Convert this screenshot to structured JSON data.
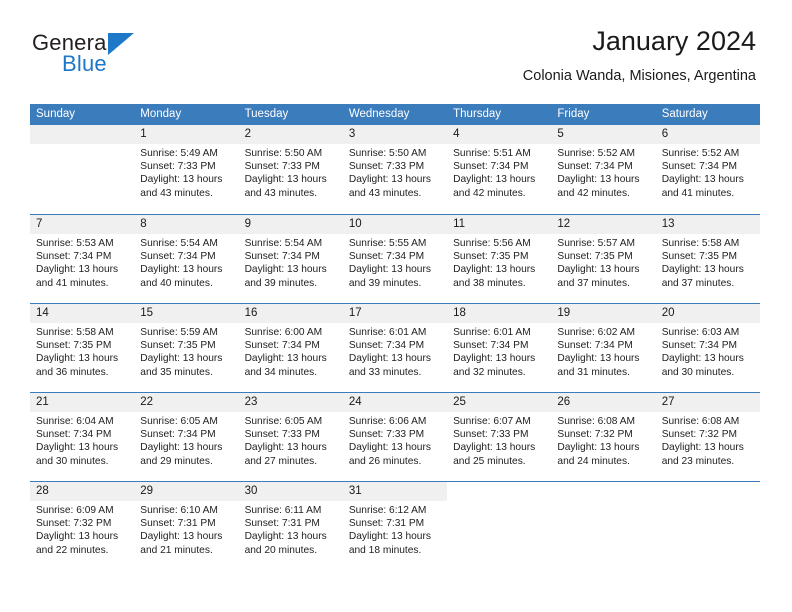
{
  "brand": {
    "name_part1": "General",
    "name_part2": "Blue",
    "accent_color": "#1e78c8",
    "triangle_icon": "triangle-icon"
  },
  "header": {
    "title": "January 2024",
    "subtitle": "Colonia Wanda, Misiones, Argentina"
  },
  "calendar": {
    "header_bg": "#3b7cbd",
    "daynumber_bg": "#f0f0f0",
    "weekdays": [
      "Sunday",
      "Monday",
      "Tuesday",
      "Wednesday",
      "Thursday",
      "Friday",
      "Saturday"
    ],
    "weeks": [
      [
        {
          "day": "",
          "sunrise": "",
          "sunset": "",
          "daylight_line1": "",
          "daylight_line2": "",
          "empty": true
        },
        {
          "day": "1",
          "sunrise": "Sunrise: 5:49 AM",
          "sunset": "Sunset: 7:33 PM",
          "daylight_line1": "Daylight: 13 hours",
          "daylight_line2": "and 43 minutes."
        },
        {
          "day": "2",
          "sunrise": "Sunrise: 5:50 AM",
          "sunset": "Sunset: 7:33 PM",
          "daylight_line1": "Daylight: 13 hours",
          "daylight_line2": "and 43 minutes."
        },
        {
          "day": "3",
          "sunrise": "Sunrise: 5:50 AM",
          "sunset": "Sunset: 7:33 PM",
          "daylight_line1": "Daylight: 13 hours",
          "daylight_line2": "and 43 minutes."
        },
        {
          "day": "4",
          "sunrise": "Sunrise: 5:51 AM",
          "sunset": "Sunset: 7:34 PM",
          "daylight_line1": "Daylight: 13 hours",
          "daylight_line2": "and 42 minutes."
        },
        {
          "day": "5",
          "sunrise": "Sunrise: 5:52 AM",
          "sunset": "Sunset: 7:34 PM",
          "daylight_line1": "Daylight: 13 hours",
          "daylight_line2": "and 42 minutes."
        },
        {
          "day": "6",
          "sunrise": "Sunrise: 5:52 AM",
          "sunset": "Sunset: 7:34 PM",
          "daylight_line1": "Daylight: 13 hours",
          "daylight_line2": "and 41 minutes."
        }
      ],
      [
        {
          "day": "7",
          "sunrise": "Sunrise: 5:53 AM",
          "sunset": "Sunset: 7:34 PM",
          "daylight_line1": "Daylight: 13 hours",
          "daylight_line2": "and 41 minutes."
        },
        {
          "day": "8",
          "sunrise": "Sunrise: 5:54 AM",
          "sunset": "Sunset: 7:34 PM",
          "daylight_line1": "Daylight: 13 hours",
          "daylight_line2": "and 40 minutes."
        },
        {
          "day": "9",
          "sunrise": "Sunrise: 5:54 AM",
          "sunset": "Sunset: 7:34 PM",
          "daylight_line1": "Daylight: 13 hours",
          "daylight_line2": "and 39 minutes."
        },
        {
          "day": "10",
          "sunrise": "Sunrise: 5:55 AM",
          "sunset": "Sunset: 7:34 PM",
          "daylight_line1": "Daylight: 13 hours",
          "daylight_line2": "and 39 minutes."
        },
        {
          "day": "11",
          "sunrise": "Sunrise: 5:56 AM",
          "sunset": "Sunset: 7:35 PM",
          "daylight_line1": "Daylight: 13 hours",
          "daylight_line2": "and 38 minutes."
        },
        {
          "day": "12",
          "sunrise": "Sunrise: 5:57 AM",
          "sunset": "Sunset: 7:35 PM",
          "daylight_line1": "Daylight: 13 hours",
          "daylight_line2": "and 37 minutes."
        },
        {
          "day": "13",
          "sunrise": "Sunrise: 5:58 AM",
          "sunset": "Sunset: 7:35 PM",
          "daylight_line1": "Daylight: 13 hours",
          "daylight_line2": "and 37 minutes."
        }
      ],
      [
        {
          "day": "14",
          "sunrise": "Sunrise: 5:58 AM",
          "sunset": "Sunset: 7:35 PM",
          "daylight_line1": "Daylight: 13 hours",
          "daylight_line2": "and 36 minutes."
        },
        {
          "day": "15",
          "sunrise": "Sunrise: 5:59 AM",
          "sunset": "Sunset: 7:35 PM",
          "daylight_line1": "Daylight: 13 hours",
          "daylight_line2": "and 35 minutes."
        },
        {
          "day": "16",
          "sunrise": "Sunrise: 6:00 AM",
          "sunset": "Sunset: 7:34 PM",
          "daylight_line1": "Daylight: 13 hours",
          "daylight_line2": "and 34 minutes."
        },
        {
          "day": "17",
          "sunrise": "Sunrise: 6:01 AM",
          "sunset": "Sunset: 7:34 PM",
          "daylight_line1": "Daylight: 13 hours",
          "daylight_line2": "and 33 minutes."
        },
        {
          "day": "18",
          "sunrise": "Sunrise: 6:01 AM",
          "sunset": "Sunset: 7:34 PM",
          "daylight_line1": "Daylight: 13 hours",
          "daylight_line2": "and 32 minutes."
        },
        {
          "day": "19",
          "sunrise": "Sunrise: 6:02 AM",
          "sunset": "Sunset: 7:34 PM",
          "daylight_line1": "Daylight: 13 hours",
          "daylight_line2": "and 31 minutes."
        },
        {
          "day": "20",
          "sunrise": "Sunrise: 6:03 AM",
          "sunset": "Sunset: 7:34 PM",
          "daylight_line1": "Daylight: 13 hours",
          "daylight_line2": "and 30 minutes."
        }
      ],
      [
        {
          "day": "21",
          "sunrise": "Sunrise: 6:04 AM",
          "sunset": "Sunset: 7:34 PM",
          "daylight_line1": "Daylight: 13 hours",
          "daylight_line2": "and 30 minutes."
        },
        {
          "day": "22",
          "sunrise": "Sunrise: 6:05 AM",
          "sunset": "Sunset: 7:34 PM",
          "daylight_line1": "Daylight: 13 hours",
          "daylight_line2": "and 29 minutes."
        },
        {
          "day": "23",
          "sunrise": "Sunrise: 6:05 AM",
          "sunset": "Sunset: 7:33 PM",
          "daylight_line1": "Daylight: 13 hours",
          "daylight_line2": "and 27 minutes."
        },
        {
          "day": "24",
          "sunrise": "Sunrise: 6:06 AM",
          "sunset": "Sunset: 7:33 PM",
          "daylight_line1": "Daylight: 13 hours",
          "daylight_line2": "and 26 minutes."
        },
        {
          "day": "25",
          "sunrise": "Sunrise: 6:07 AM",
          "sunset": "Sunset: 7:33 PM",
          "daylight_line1": "Daylight: 13 hours",
          "daylight_line2": "and 25 minutes."
        },
        {
          "day": "26",
          "sunrise": "Sunrise: 6:08 AM",
          "sunset": "Sunset: 7:32 PM",
          "daylight_line1": "Daylight: 13 hours",
          "daylight_line2": "and 24 minutes."
        },
        {
          "day": "27",
          "sunrise": "Sunrise: 6:08 AM",
          "sunset": "Sunset: 7:32 PM",
          "daylight_line1": "Daylight: 13 hours",
          "daylight_line2": "and 23 minutes."
        }
      ],
      [
        {
          "day": "28",
          "sunrise": "Sunrise: 6:09 AM",
          "sunset": "Sunset: 7:32 PM",
          "daylight_line1": "Daylight: 13 hours",
          "daylight_line2": "and 22 minutes."
        },
        {
          "day": "29",
          "sunrise": "Sunrise: 6:10 AM",
          "sunset": "Sunset: 7:31 PM",
          "daylight_line1": "Daylight: 13 hours",
          "daylight_line2": "and 21 minutes."
        },
        {
          "day": "30",
          "sunrise": "Sunrise: 6:11 AM",
          "sunset": "Sunset: 7:31 PM",
          "daylight_line1": "Daylight: 13 hours",
          "daylight_line2": "and 20 minutes."
        },
        {
          "day": "31",
          "sunrise": "Sunrise: 6:12 AM",
          "sunset": "Sunset: 7:31 PM",
          "daylight_line1": "Daylight: 13 hours",
          "daylight_line2": "and 18 minutes."
        },
        {
          "day": "",
          "sunrise": "",
          "sunset": "",
          "daylight_line1": "",
          "daylight_line2": "",
          "blank": true
        },
        {
          "day": "",
          "sunrise": "",
          "sunset": "",
          "daylight_line1": "",
          "daylight_line2": "",
          "blank": true
        },
        {
          "day": "",
          "sunrise": "",
          "sunset": "",
          "daylight_line1": "",
          "daylight_line2": "",
          "blank": true
        }
      ]
    ]
  }
}
